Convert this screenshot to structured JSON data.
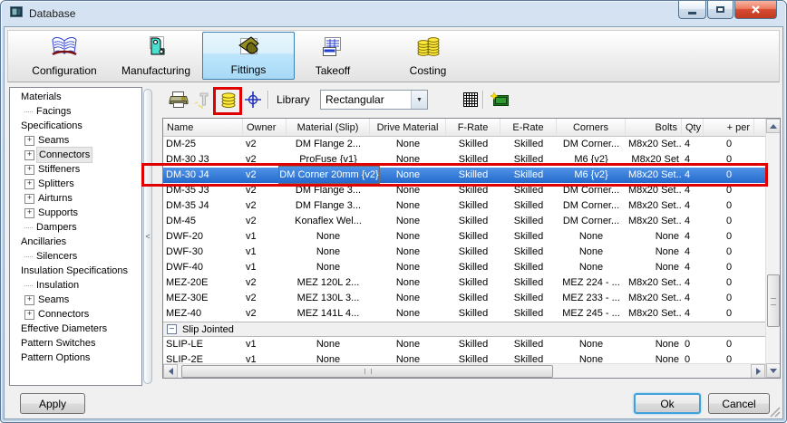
{
  "window": {
    "title": "Database"
  },
  "window_controls": {
    "minimize": "minimize",
    "maximize": "maximize",
    "close": "close"
  },
  "tabs": [
    {
      "label": "Configuration",
      "selected": false
    },
    {
      "label": "Manufacturing",
      "selected": false
    },
    {
      "label": "Fittings",
      "selected": true
    },
    {
      "label": "Takeoff",
      "selected": false
    },
    {
      "label": "Costing",
      "selected": false
    }
  ],
  "toolbar": {
    "library_label": "Library",
    "library_value": "Rectangular"
  },
  "icons": {
    "plus": "+",
    "minus": "−",
    "collapse": "<",
    "combo_arrow": "▼"
  },
  "sidebar": {
    "items": [
      {
        "label": "Materials",
        "level": 0,
        "glyph": "none",
        "selected": false
      },
      {
        "label": "Facings",
        "level": 1,
        "glyph": "leaf",
        "selected": false
      },
      {
        "label": "Specifications",
        "level": 0,
        "glyph": "none",
        "selected": false
      },
      {
        "label": "Seams",
        "level": 1,
        "glyph": "plus",
        "selected": false
      },
      {
        "label": "Connectors",
        "level": 1,
        "glyph": "plus",
        "selected": true
      },
      {
        "label": "Stiffeners",
        "level": 1,
        "glyph": "plus",
        "selected": false
      },
      {
        "label": "Splitters",
        "level": 1,
        "glyph": "plus",
        "selected": false
      },
      {
        "label": "Airturns",
        "level": 1,
        "glyph": "plus",
        "selected": false
      },
      {
        "label": "Supports",
        "level": 1,
        "glyph": "plus",
        "selected": false
      },
      {
        "label": "Dampers",
        "level": 1,
        "glyph": "leaf",
        "selected": false
      },
      {
        "label": "Ancillaries",
        "level": 0,
        "glyph": "none",
        "selected": false
      },
      {
        "label": "Silencers",
        "level": 1,
        "glyph": "leaf",
        "selected": false
      },
      {
        "label": "Insulation Specifications",
        "level": 0,
        "glyph": "none",
        "selected": false
      },
      {
        "label": "Insulation",
        "level": 1,
        "glyph": "leaf",
        "selected": false
      },
      {
        "label": "Seams",
        "level": 1,
        "glyph": "plus",
        "selected": false
      },
      {
        "label": "Connectors",
        "level": 1,
        "glyph": "plus",
        "selected": false
      },
      {
        "label": "Effective Diameters",
        "level": 0,
        "glyph": "none",
        "selected": false
      },
      {
        "label": "Pattern Switches",
        "level": 0,
        "glyph": "none",
        "selected": false
      },
      {
        "label": "Pattern Options",
        "level": 0,
        "glyph": "none",
        "selected": false
      }
    ]
  },
  "table": {
    "columns": [
      {
        "label": "Name"
      },
      {
        "label": "Owner"
      },
      {
        "label": "Material (Slip)"
      },
      {
        "label": "Drive Material"
      },
      {
        "label": "F-Rate"
      },
      {
        "label": "E-Rate"
      },
      {
        "label": "Corners"
      },
      {
        "label": "Bolts"
      },
      {
        "label": "Qty"
      },
      {
        "label": "+ per"
      }
    ],
    "selected_row_tooltip": "DM Corner 20mm {v2}",
    "rows": [
      {
        "type": "data",
        "name": "DM-25",
        "owner": "v2",
        "material": "DM Flange 2...",
        "drive_material": "None",
        "f_rate": "Skilled",
        "e_rate": "Skilled",
        "corners": "DM Corner...",
        "bolts": "M8x20 Set...",
        "qty": "4",
        "plus_per": "0",
        "selected": false
      },
      {
        "type": "data",
        "name": "DM-30 J3",
        "owner": "v2",
        "material": "ProFuse {v1}",
        "drive_material": "None",
        "f_rate": "Skilled",
        "e_rate": "Skilled",
        "corners": "M6 {v2}",
        "bolts": "M8x20 Set",
        "qty": "4",
        "plus_per": "0",
        "selected": false
      },
      {
        "type": "data",
        "name": "DM-30 J4",
        "owner": "v2",
        "material": "",
        "drive_material": "None",
        "f_rate": "Skilled",
        "e_rate": "Skilled",
        "corners": "M6 {v2}",
        "bolts": "M8x20 Set...",
        "qty": "4",
        "plus_per": "0",
        "selected": true
      },
      {
        "type": "data",
        "name": "DM-35 J3",
        "owner": "v2",
        "material": "DM Flange 3...",
        "drive_material": "None",
        "f_rate": "Skilled",
        "e_rate": "Skilled",
        "corners": "DM Corner...",
        "bolts": "M8x20 Set...",
        "qty": "4",
        "plus_per": "0",
        "selected": false
      },
      {
        "type": "data",
        "name": "DM-35 J4",
        "owner": "v2",
        "material": "DM Flange 3...",
        "drive_material": "None",
        "f_rate": "Skilled",
        "e_rate": "Skilled",
        "corners": "DM Corner...",
        "bolts": "M8x20 Set...",
        "qty": "4",
        "plus_per": "0",
        "selected": false
      },
      {
        "type": "data",
        "name": "DM-45",
        "owner": "v2",
        "material": "Konaflex Wel...",
        "drive_material": "None",
        "f_rate": "Skilled",
        "e_rate": "Skilled",
        "corners": "DM Corner...",
        "bolts": "M8x20 Set...",
        "qty": "4",
        "plus_per": "0",
        "selected": false
      },
      {
        "type": "data",
        "name": "DWF-20",
        "owner": "v1",
        "material": "None",
        "drive_material": "None",
        "f_rate": "Skilled",
        "e_rate": "Skilled",
        "corners": "None",
        "bolts": "None",
        "qty": "4",
        "plus_per": "0",
        "selected": false
      },
      {
        "type": "data",
        "name": "DWF-30",
        "owner": "v1",
        "material": "None",
        "drive_material": "None",
        "f_rate": "Skilled",
        "e_rate": "Skilled",
        "corners": "None",
        "bolts": "None",
        "qty": "4",
        "plus_per": "0",
        "selected": false
      },
      {
        "type": "data",
        "name": "DWF-40",
        "owner": "v1",
        "material": "None",
        "drive_material": "None",
        "f_rate": "Skilled",
        "e_rate": "Skilled",
        "corners": "None",
        "bolts": "None",
        "qty": "4",
        "plus_per": "0",
        "selected": false
      },
      {
        "type": "data",
        "name": "MEZ-20E",
        "owner": "v2",
        "material": "MEZ 120L 2...",
        "drive_material": "None",
        "f_rate": "Skilled",
        "e_rate": "Skilled",
        "corners": "MEZ 224 - ...",
        "bolts": "M8x20 Set...",
        "qty": "4",
        "plus_per": "0",
        "selected": false
      },
      {
        "type": "data",
        "name": "MEZ-30E",
        "owner": "v2",
        "material": "MEZ 130L 3...",
        "drive_material": "None",
        "f_rate": "Skilled",
        "e_rate": "Skilled",
        "corners": "MEZ 233 - ...",
        "bolts": "M8x20 Set...",
        "qty": "4",
        "plus_per": "0",
        "selected": false
      },
      {
        "type": "data",
        "name": "MEZ-40",
        "owner": "v2",
        "material": "MEZ 141L 4...",
        "drive_material": "None",
        "f_rate": "Skilled",
        "e_rate": "Skilled",
        "corners": "MEZ 245 - ...",
        "bolts": "M8x20 Set...",
        "qty": "4",
        "plus_per": "0",
        "selected": false
      },
      {
        "type": "group",
        "label": "Slip Jointed"
      },
      {
        "type": "data",
        "name": "SLIP-LE",
        "owner": "v1",
        "material": "None",
        "drive_material": "None",
        "f_rate": "Skilled",
        "e_rate": "Skilled",
        "corners": "None",
        "bolts": "None",
        "qty": "0",
        "plus_per": "0",
        "selected": false
      },
      {
        "type": "data",
        "name": "SLIP-2E",
        "owner": "v1",
        "material": "None",
        "drive_material": "None",
        "f_rate": "Skilled",
        "e_rate": "Skilled",
        "corners": "None",
        "bolts": "None",
        "qty": "0",
        "plus_per": "0",
        "selected": false
      }
    ]
  },
  "buttons": {
    "apply": "Apply",
    "ok": "Ok",
    "cancel": "Cancel"
  },
  "colors": {
    "annotation": "#e00000",
    "selection_top": "#4f94e6",
    "selection_bottom": "#2569cd",
    "tab_selected_border": "#3c7fb1"
  }
}
